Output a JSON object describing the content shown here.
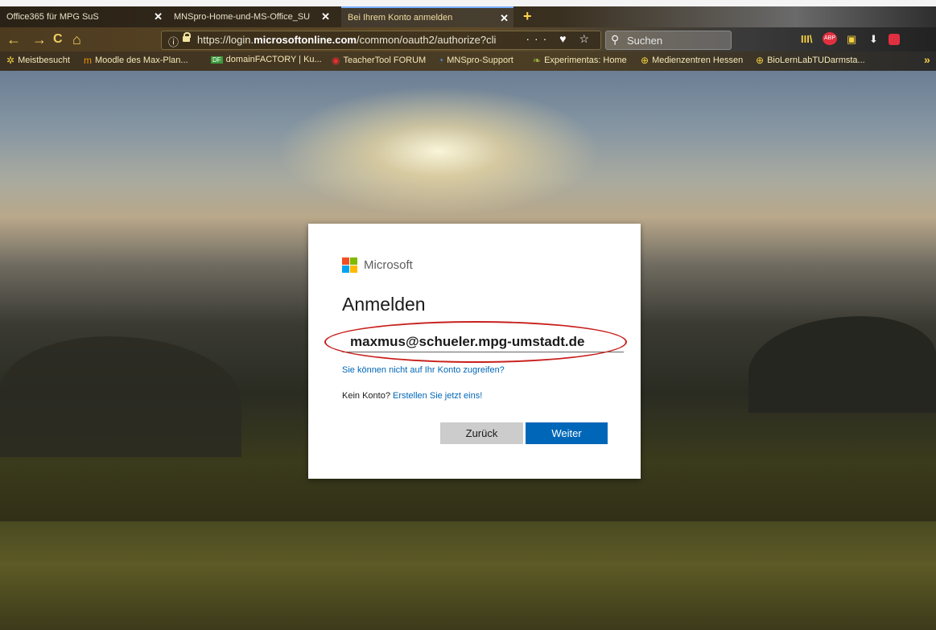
{
  "browser": {
    "tabs": [
      {
        "label": "Office365 für MPG SuS",
        "close": "✕",
        "active": false
      },
      {
        "label": "MNSpro-Home-und-MS-Office_SU",
        "close": "✕",
        "active": false
      },
      {
        "label": "Bei Ihrem Konto anmelden",
        "close": "✕",
        "active": true
      }
    ],
    "new_tab": "+",
    "nav": {
      "back": "←",
      "forward": "→",
      "reload": "C",
      "home": "⌂"
    },
    "url": {
      "info_icon": "ⓘ",
      "prefix": "https://login.",
      "domain": "microsoftonline.com",
      "path": "/common/oauth2/authorize?cli",
      "actions": "··· ♥ ☆"
    },
    "search_placeholder": "Suchen",
    "toolbar_icons": [
      "library-icon",
      "adblock-icon",
      "sidebar-icon",
      "download-icon",
      "extension-icon"
    ],
    "bookmarks": [
      {
        "icon": "gear-icon",
        "label": "Meistbesucht"
      },
      {
        "icon": "moodle-icon",
        "label": "Moodle des Max-Plan..."
      },
      {
        "icon": "df-icon",
        "label": "domainFACTORY | Ku..."
      },
      {
        "icon": "target-icon",
        "label": "TeacherTool FORUM"
      },
      {
        "icon": "mnspro-icon",
        "label": "MNSpro-Support"
      },
      {
        "icon": "leaf-icon",
        "label": "Experimentas: Home"
      },
      {
        "icon": "globe-icon",
        "label": "Medienzentren Hessen"
      },
      {
        "icon": "globe-icon",
        "label": "BioLernLabTUDarmsta..."
      }
    ],
    "bookmarks_more": "»"
  },
  "dialog": {
    "brand": "Microsoft",
    "title": "Anmelden",
    "email_value": "maxmus@schueler.mpg-umstadt.de",
    "cant_access": "Sie können nicht auf Ihr Konto zugreifen?",
    "no_account_text": "Kein Konto?",
    "create_link": "Erstellen Sie jetzt eins!",
    "back_button": "Zurück",
    "next_button": "Weiter"
  },
  "colors": {
    "accent": "#0067b8",
    "annotation_ring": "#c8201d"
  }
}
